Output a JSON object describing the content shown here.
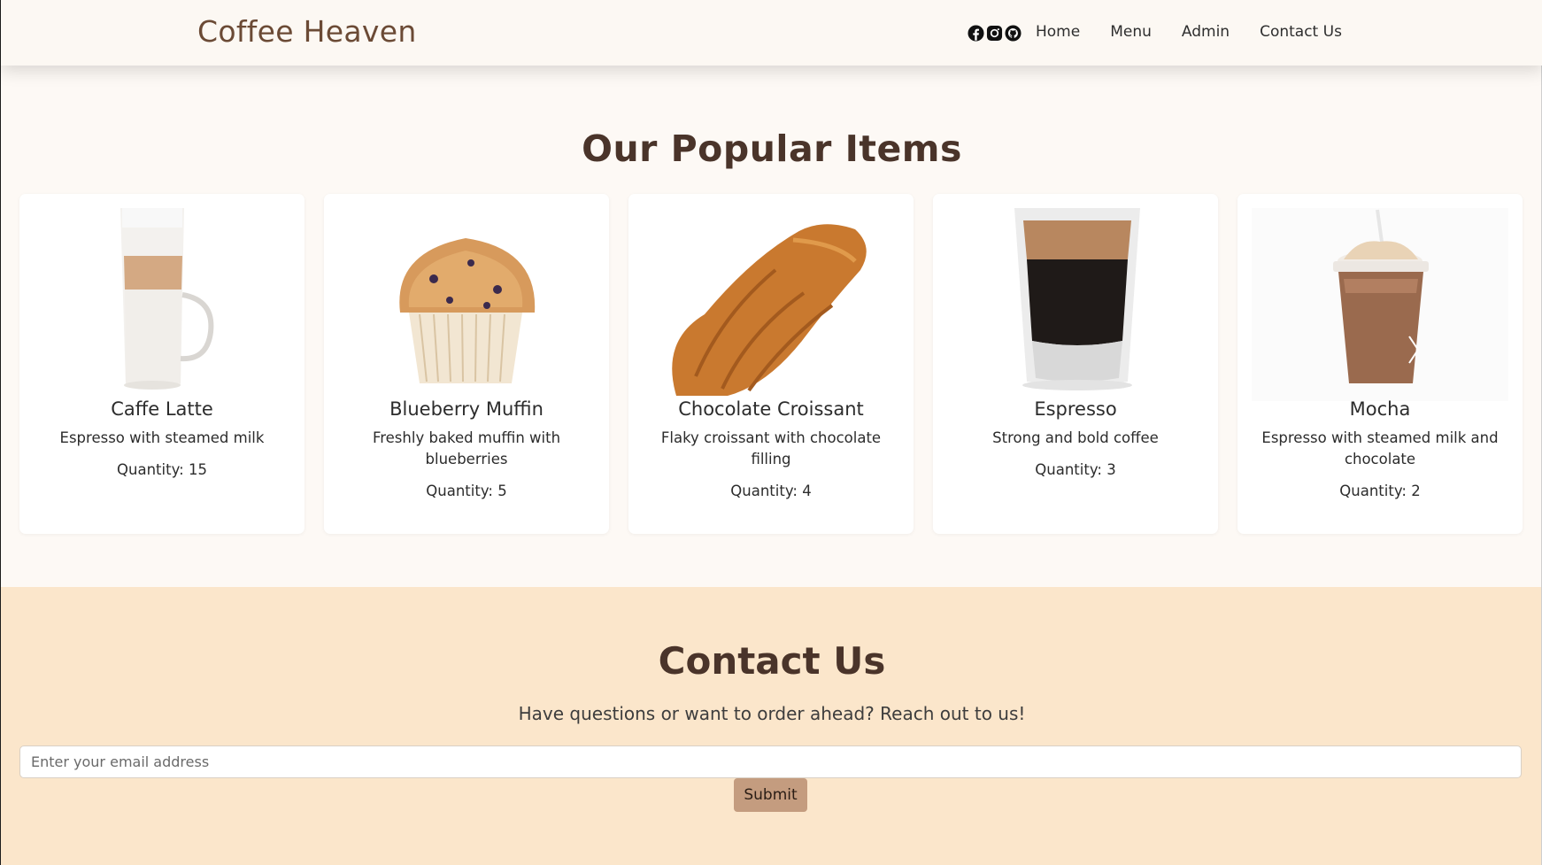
{
  "navbar": {
    "brand": "Coffee Heaven",
    "social_icons": [
      "facebook-icon",
      "instagram-icon",
      "github-icon"
    ],
    "links": [
      "Home",
      "Menu",
      "Admin",
      "Contact Us"
    ]
  },
  "popular": {
    "title": "Our Popular Items",
    "items": [
      {
        "name": "Caffe Latte",
        "description": "Espresso with steamed milk",
        "quantity": "Quantity: 15",
        "image_icon": "latte-glass-image"
      },
      {
        "name": "Blueberry Muffin",
        "description": "Freshly baked muffin with blueberries",
        "quantity": "Quantity: 5",
        "image_icon": "muffin-image"
      },
      {
        "name": "Chocolate Croissant",
        "description": "Flaky croissant with chocolate filling",
        "quantity": "Quantity: 4",
        "image_icon": "croissant-image"
      },
      {
        "name": "Espresso",
        "description": "Strong and bold coffee",
        "quantity": "Quantity: 3",
        "image_icon": "espresso-glass-image"
      },
      {
        "name": "Mocha",
        "description": "Espresso with steamed milk and chocolate",
        "quantity": "Quantity: 2",
        "image_icon": "mocha-cup-image"
      }
    ]
  },
  "contact": {
    "title": "Contact Us",
    "subtitle": "Have questions or want to order ahead? Reach out to us!",
    "email_placeholder": "Enter your email address",
    "email_value": "",
    "submit_label": "Submit"
  },
  "colors": {
    "brand": "#6b4a35",
    "page_bg": "#fdf9f5",
    "contact_bg": "#fbe6cb",
    "submit_bg": "#c49c7f",
    "heading": "#4a342a"
  }
}
